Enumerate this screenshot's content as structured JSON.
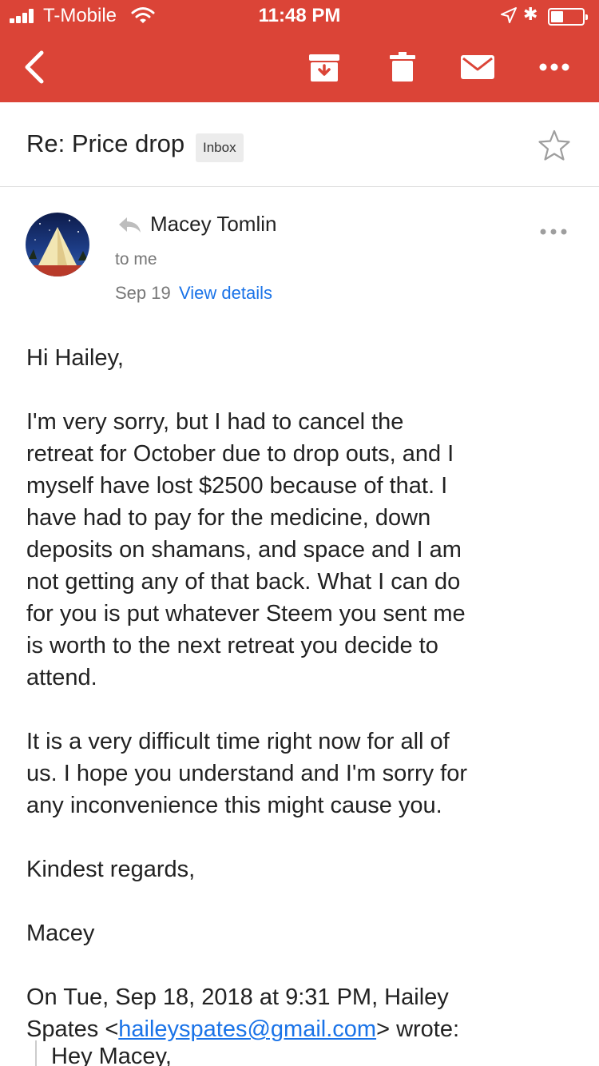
{
  "status_bar": {
    "carrier": "T-Mobile",
    "time": "11:48 PM"
  },
  "toolbar": {
    "icons": [
      "back-arrow-icon",
      "archive-icon",
      "trash-icon",
      "mail-icon",
      "more-icon"
    ]
  },
  "email": {
    "subject": "Re: Price drop",
    "label": "Inbox",
    "sender": "Macey Tomlin",
    "recipient": "to me",
    "date": "Sep 19",
    "details_link": "View details",
    "body": {
      "greeting": "Hi Hailey,",
      "paragraph1": "I'm very sorry, but I had to cancel the\nretreat for October due to drop outs, and I\nmyself have lost $2500 because of that. I\nhave had to pay for the medicine, down\ndeposits on shamans, and space and I am\nnot getting any of that back. What I can do\nfor you is put whatever Steem you sent me\nis worth to the next retreat you decide to\nattend.",
      "paragraph2": "It is a very difficult time right now for all of\nus. I hope you understand and I'm sorry for\nany inconvenience this might cause you.",
      "closing": "Kindest regards,",
      "signature": "Macey",
      "quote_header_line1": "On Tue, Sep 18, 2018 at 9:31 PM, Hailey",
      "quote_header_prefix": "Spates <",
      "quote_email": "haileyspates@gmail.com",
      "quote_header_suffix": "> wrote:",
      "quoted_first_line": "Hey Macey,"
    }
  },
  "colors": {
    "app_bar": "#db4437",
    "link": "#1a73e8"
  }
}
